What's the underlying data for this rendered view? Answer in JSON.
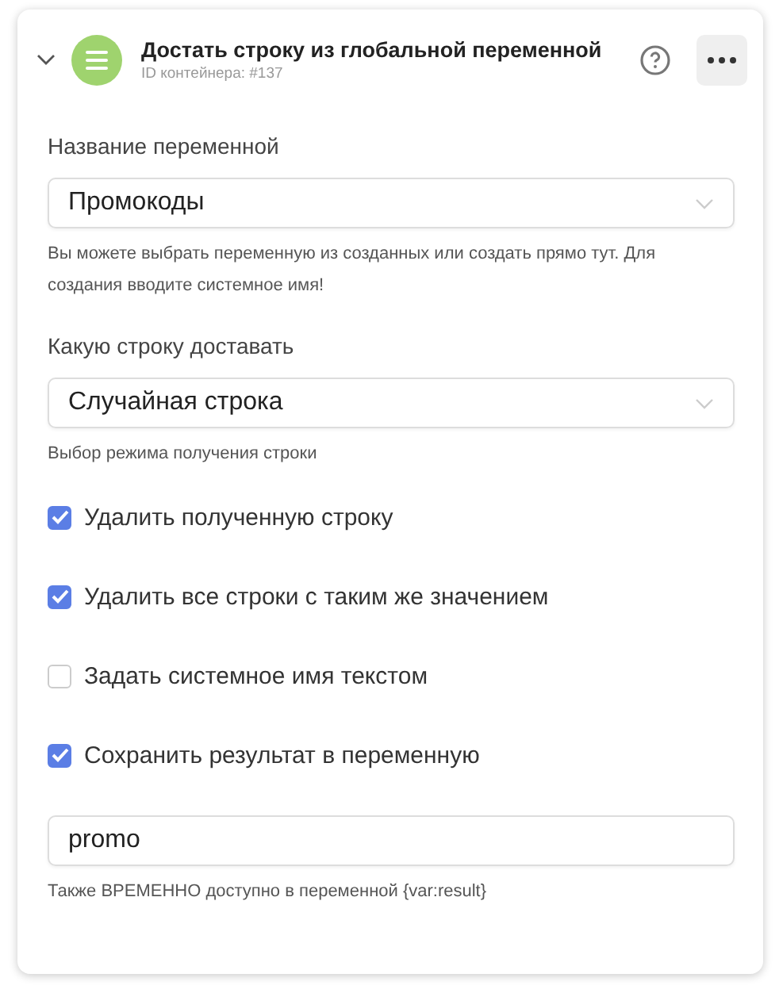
{
  "header": {
    "expanded": true,
    "title": "Достать строку из глобальной переменной",
    "subtitle": "ID контейнера: #137"
  },
  "fields": [
    {
      "kind": "select",
      "label": "Название переменной",
      "value": "Промокоды",
      "hint": "Вы можете выбрать переменную из созданных или создать прямо тут. Для создания вводите системное имя!"
    },
    {
      "kind": "select",
      "label": "Какую строку доставать",
      "value": "Случайная строка",
      "hint": "Выбор режима получения строки"
    },
    {
      "kind": "checkbox",
      "label": "Удалить полученную строку",
      "checked": true
    },
    {
      "kind": "checkbox",
      "label": "Удалить все строки с таким же значением",
      "checked": true
    },
    {
      "kind": "checkbox",
      "label": "Задать системное имя текстом",
      "checked": false
    },
    {
      "kind": "checkbox",
      "label": "Сохранить результат в переменную",
      "checked": true
    },
    {
      "kind": "input",
      "value": "promo",
      "hint": "Также ВРЕМЕННО доступно в переменной {var:result}"
    }
  ]
}
